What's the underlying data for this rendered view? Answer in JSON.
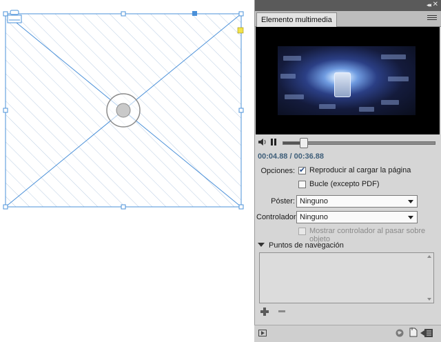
{
  "panel": {
    "tab_label": "Elemento multimedia",
    "collapse_glyph": "◂◂",
    "close_glyph": "✕",
    "timecode": "00:04.88 / 00:36.88",
    "playback": {
      "position_fraction": 0.1323
    },
    "options": {
      "label": "Opciones:",
      "play_on_load": {
        "label": "Reproducir al cargar la página",
        "checked": true
      },
      "loop": {
        "label": "Bucle (excepto PDF)",
        "checked": false
      }
    },
    "poster": {
      "label": "Póster:",
      "value": "Ninguno"
    },
    "controller": {
      "label": "Controlador:",
      "value": "Ninguno"
    },
    "show_controller_rollover": {
      "label": "Mostrar controlador al pasar sobre objeto",
      "checked": false,
      "disabled": true
    },
    "nav_points": {
      "title": "Puntos de navegación"
    },
    "icons": {
      "speaker": "speaker-icon",
      "pause": "pause-icon",
      "add": "add-icon",
      "remove": "minus-icon",
      "preview": "preview-icon",
      "url": "url-icon",
      "page": "page-icon",
      "export": "export-icon"
    }
  },
  "colors": {
    "panel_bg": "#d6d6d6",
    "frame_stroke": "#4a90d9",
    "timecode": "#3f5f7a",
    "anchor_yellow": "#f2e34a",
    "anchor_blue": "#4a90d9"
  }
}
